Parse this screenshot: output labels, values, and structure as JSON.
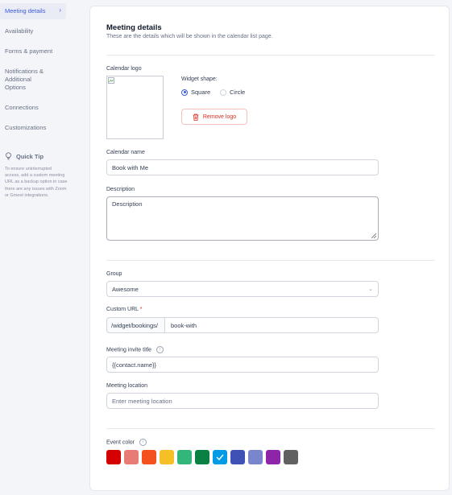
{
  "sidebar": {
    "items": [
      {
        "label": "Meeting details"
      },
      {
        "label": "Availability"
      },
      {
        "label": "Forms & payment"
      },
      {
        "label": "Notifications & Additional Options"
      },
      {
        "label": "Connections"
      },
      {
        "label": "Customizations"
      }
    ],
    "tip_title": "Quick Tip",
    "tip_body": "To ensure uninterrupted access, add a custom meeting URL as a backup option in case there are any issues with Zoom or Gmeet integrations."
  },
  "header": {
    "title": "Meeting details",
    "subtitle": "These are the details which will be shown in the calendar list page."
  },
  "logo": {
    "label": "Calendar logo",
    "widget_shape_label": "Widget shape:",
    "options": [
      "Square",
      "Circle"
    ],
    "selected": "Square",
    "remove_label": "Remove logo"
  },
  "fields": {
    "calendar_name_label": "Calendar name",
    "calendar_name_value": "Book with Me",
    "description_label": "Description",
    "description_value": "Description",
    "group_label": "Group",
    "group_value": "Awesome",
    "custom_url_label": "Custom URL",
    "custom_url_required": "*",
    "custom_url_prefix": "/widget/bookings/",
    "custom_url_value": "book-with",
    "invite_title_label": "Meeting invite title",
    "invite_title_value": "{{contact.name}}",
    "location_label": "Meeting location",
    "location_placeholder": "Enter meeting location",
    "event_color_label": "Event color"
  },
  "colors": {
    "accent": "#3b5bdb",
    "swatches": [
      "#d50000",
      "#e67c73",
      "#f4511e",
      "#f6bf26",
      "#33b679",
      "#0b8043",
      "#039be5",
      "#3f51b5",
      "#7986cb",
      "#8e24aa",
      "#616161"
    ],
    "selected_index": 6
  }
}
